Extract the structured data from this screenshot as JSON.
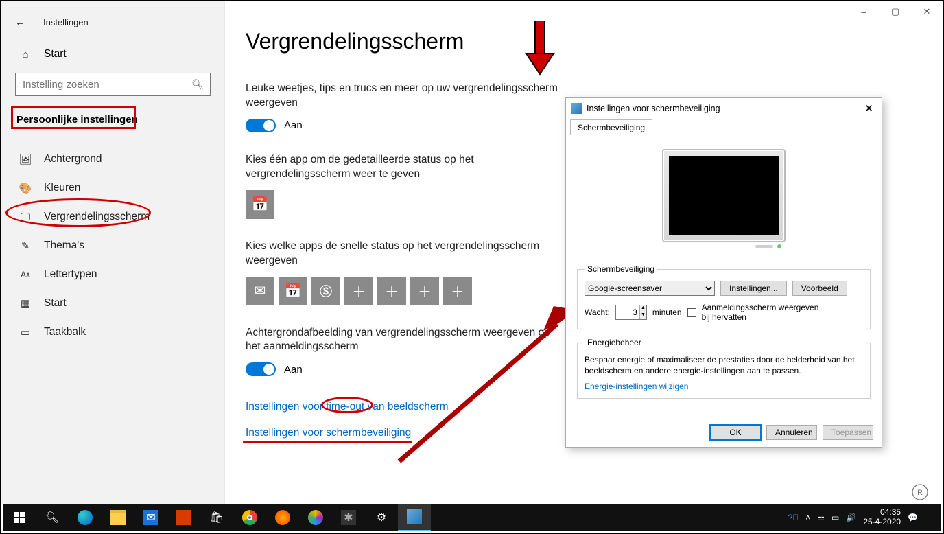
{
  "window": {
    "title": "Instellingen",
    "minimize": "–",
    "maximize": "▢",
    "close": "✕"
  },
  "sidebar": {
    "home": "Start",
    "search_placeholder": "Instelling zoeken",
    "category": "Persoonlijke instellingen",
    "items": [
      {
        "icon": "▭",
        "label": "Achtergrond"
      },
      {
        "icon": "🎨",
        "label": "Kleuren"
      },
      {
        "icon": "⊞",
        "label": "Vergrendelingsscherm"
      },
      {
        "icon": "✎",
        "label": "Thema's"
      },
      {
        "icon": "Aᴀ",
        "label": "Lettertypen"
      },
      {
        "icon": "▦",
        "label": "Start"
      },
      {
        "icon": "▭",
        "label": "Taakbalk"
      }
    ]
  },
  "main": {
    "title": "Vergrendelingsscherm",
    "block1_text": "Leuke weetjes, tips en trucs en meer op uw vergrendelingsscherm weergeven",
    "toggle_on": "Aan",
    "block2_text": "Kies één app om de gedetailleerde status op het vergrendelingsscherm weer te geven",
    "block3_text": "Kies welke apps de snelle status op het vergrendelingsscherm weergeven",
    "block4_text": "Achtergrondafbeelding van vergrendelingsscherm weergeven op het aanmeldingsscherm",
    "link1": "Instellingen voor time-out van beeldscherm",
    "link2": "Instellingen voor schermbeveiliging"
  },
  "dialog": {
    "title": "Instellingen voor schermbeveiliging",
    "tab": "Schermbeveiliging",
    "group1": "Schermbeveiliging",
    "dropdown_value": "Google-screensaver",
    "btn_settings": "Instellingen...",
    "btn_preview": "Voorbeeld",
    "wait_label": "Wacht:",
    "wait_value": "3",
    "minutes": "minuten",
    "checkbox_label": "Aanmeldingsscherm weergeven bij hervatten",
    "group2": "Energiebeheer",
    "energy_text": "Bespaar energie of maximaliseer de prestaties door de helderheid van het beeldscherm en andere energie-instellingen aan te passen.",
    "energy_link": "Energie-instellingen wijzigen",
    "ok": "OK",
    "cancel": "Annuleren",
    "apply": "Toepassen"
  },
  "taskbar": {
    "time": "04:35",
    "date": "25-4-2020"
  }
}
